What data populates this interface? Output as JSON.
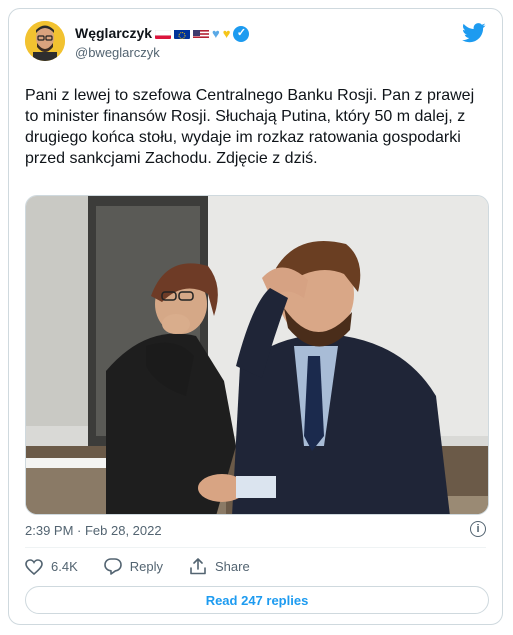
{
  "author": {
    "name": "Węglarczyk",
    "handle": "@bweglarczyk",
    "emojis": [
      "poland-flag-icon",
      "eu-flag-icon",
      "usa-flag-icon",
      "blue-heart-icon",
      "yellow-heart-icon"
    ],
    "verified": true
  },
  "tweet": {
    "text": "Pani z lewej to szefowa Centralnego Banku Rosji. Pan z prawej to minister finansów Rosji. Słuchają Putina, który 50 m dalej, z drugiego końca stołu, wydaje im rozkaz ratowania gospodarki przed sankcjami Zachodu. Zdjęcie z dziś.",
    "timestamp": "2:39 PM · Feb 28, 2022"
  },
  "actions": {
    "likes": "6.4K",
    "reply_label": "Reply",
    "share_label": "Share"
  },
  "footer": {
    "read_replies": "Read 247 replies"
  },
  "colors": {
    "accent": "#1d9bf0",
    "text": "#0f1419",
    "muted": "#536471",
    "border": "#cfd9de"
  }
}
